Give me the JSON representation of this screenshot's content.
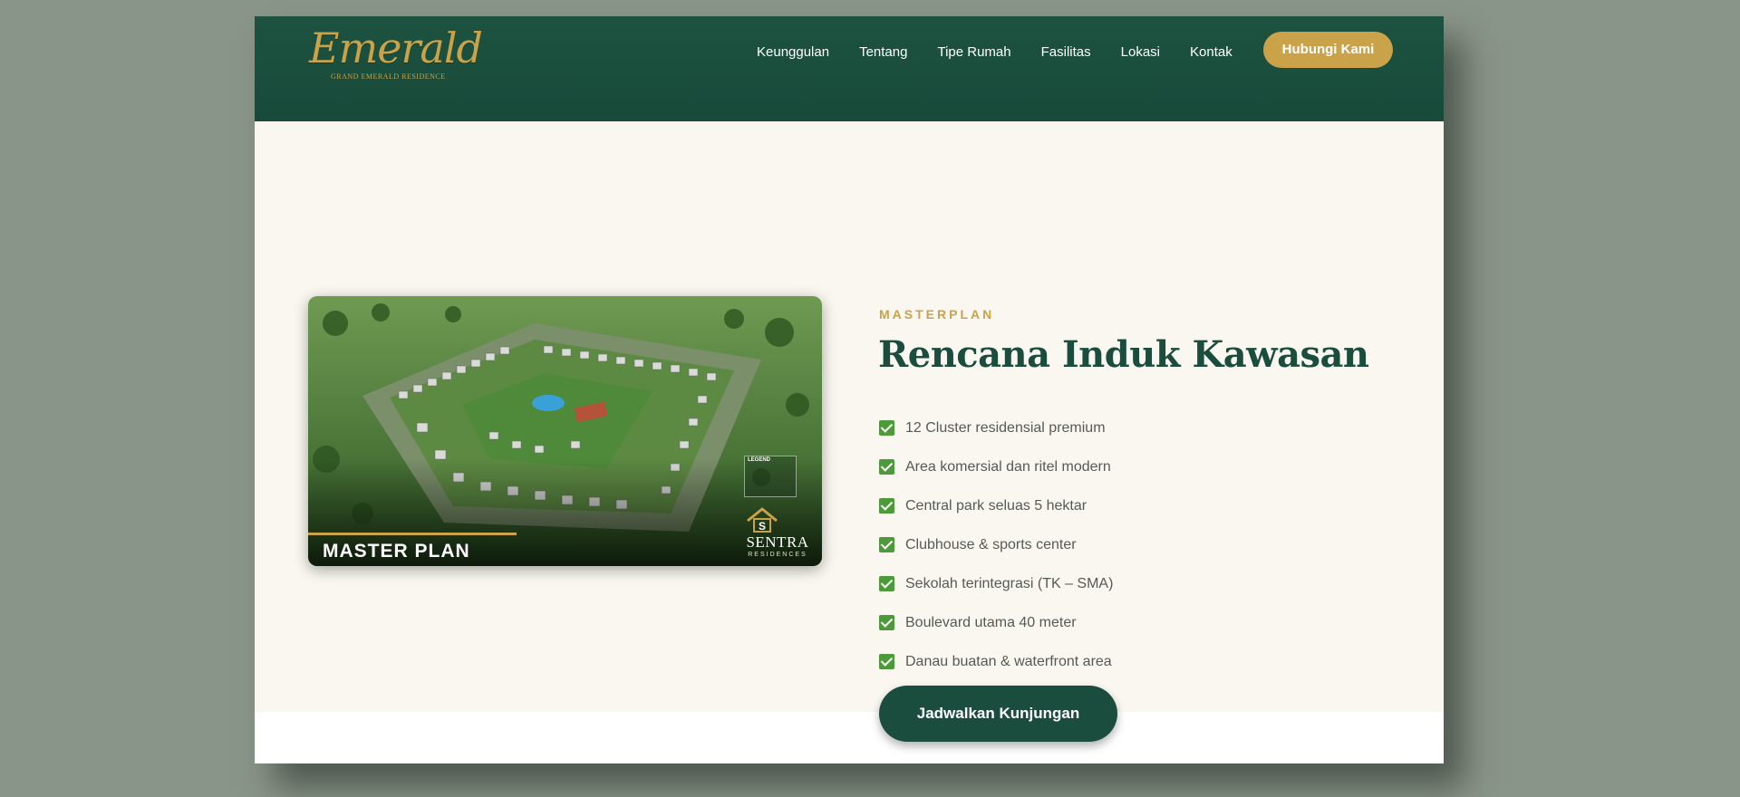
{
  "header": {
    "logo_text": "Emerald",
    "logo_subtitle": "GRAND EMERALD RESIDENCE",
    "nav": [
      "Keunggulan",
      "Tentang",
      "Tipe Rumah",
      "Fasilitas",
      "Lokasi",
      "Kontak"
    ],
    "cta_label": "Hubungi Kami"
  },
  "masterplan": {
    "image_label": "MASTER PLAN",
    "image_brand": "SENTRA",
    "image_brand_sub": "RESIDENCES",
    "image_legend_title": "LEGEND",
    "eyebrow": "MASTERPLAN",
    "title": "Rencana Induk Kawasan",
    "features": [
      "12 Cluster residensial premium",
      "Area komersial dan ritel modern",
      "Central park seluas 5 hektar",
      "Clubhouse & sports center",
      "Sekolah terintegrasi (TK – SMA)",
      "Boulevard utama 40 meter",
      "Danau buatan & waterfront area"
    ],
    "cta_label": "Jadwalkan Kunjungan"
  },
  "icons": {
    "check": "check-icon",
    "chat": "whatsapp-icon"
  },
  "colors": {
    "primary": "#1b4d3e",
    "accent": "#c9a24a",
    "check": "#4c9a3a",
    "whatsapp": "#25d366"
  }
}
